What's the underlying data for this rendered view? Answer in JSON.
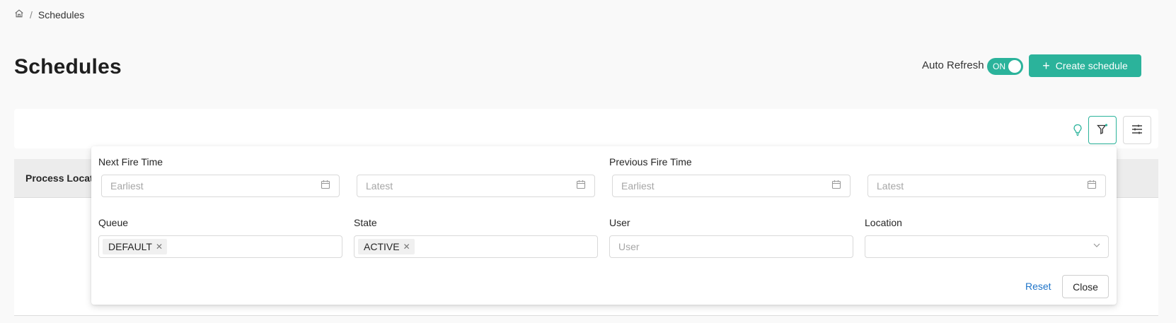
{
  "breadcrumb": {
    "current": "Schedules",
    "separator": "/"
  },
  "page": {
    "title": "Schedules"
  },
  "header": {
    "auto_refresh_label": "Auto Refresh",
    "auto_refresh_state": "ON",
    "create_button_label": "Create schedule"
  },
  "table": {
    "columns": [
      "Process Locat"
    ]
  },
  "filters": {
    "next_fire_time": {
      "label": "Next Fire Time",
      "earliest_placeholder": "Earliest",
      "latest_placeholder": "Latest"
    },
    "previous_fire_time": {
      "label": "Previous Fire Time",
      "earliest_placeholder": "Earliest",
      "latest_placeholder": "Latest"
    },
    "queue": {
      "label": "Queue",
      "tags": [
        "DEFAULT"
      ]
    },
    "state": {
      "label": "State",
      "tags": [
        "ACTIVE"
      ]
    },
    "user": {
      "label": "User",
      "placeholder": "User"
    },
    "location": {
      "label": "Location",
      "value": ""
    },
    "reset_label": "Reset",
    "close_label": "Close"
  },
  "colors": {
    "accent": "#2bb39b",
    "link": "#1f74c9",
    "background": "#f9f9f9"
  },
  "icons": [
    "home-icon",
    "plus-icon",
    "lightbulb-icon",
    "filter-icon",
    "sliders-icon",
    "calendar-icon",
    "close-icon",
    "chevron-down-icon"
  ]
}
